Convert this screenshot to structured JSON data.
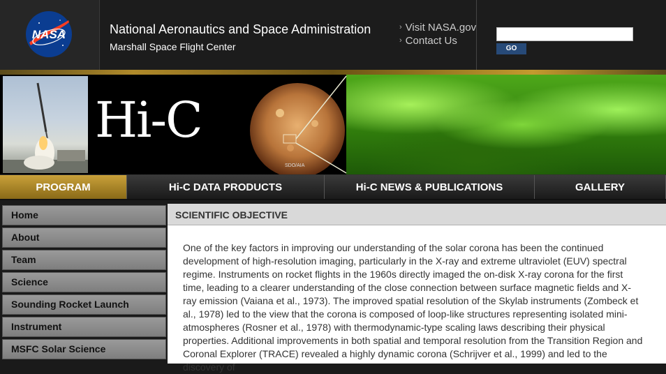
{
  "header": {
    "agency": "National Aeronautics and Space Administration",
    "center": "Marshall Space Flight Center",
    "links": [
      "Visit NASA.gov",
      "Contact Us"
    ],
    "search_placeholder": "",
    "go_label": "GO"
  },
  "banner": {
    "logo_text": "Hi-C",
    "sdo_label": "SDO/AIA"
  },
  "nav": {
    "tabs": [
      {
        "label": "PROGRAM"
      },
      {
        "label": "Hi-C DATA PRODUCTS"
      },
      {
        "label": "Hi-C NEWS & PUBLICATIONS"
      },
      {
        "label": "GALLERY"
      }
    ]
  },
  "sidebar": {
    "items": [
      {
        "label": "Home"
      },
      {
        "label": "About"
      },
      {
        "label": "Team"
      },
      {
        "label": "Science"
      },
      {
        "label": "Sounding Rocket Launch"
      },
      {
        "label": "Instrument"
      },
      {
        "label": "MSFC Solar Science"
      }
    ]
  },
  "main": {
    "title": "SCIENTIFIC OBJECTIVE",
    "body": "One of the key factors in improving our understanding of the solar corona has been the continued development of high-resolution imaging, particularly in the X-ray and extreme ultraviolet (EUV) spectral regime. Instruments on rocket flights in the 1960s directly imaged the on-disk X-ray corona for the first time, leading to a clearer understanding of the close connection between surface magnetic fields and X-ray emission (Vaiana et al., 1973). The improved spatial resolution of the Skylab instruments (Zombeck et al., 1978) led to the view that the corona is composed of loop-like structures representing isolated mini-atmospheres (Rosner et al., 1978) with thermodynamic-type scaling laws describing their physical properties. Additional improvements in both spatial and temporal resolution from the Transition Region and Coronal Explorer (TRACE) revealed a highly dynamic corona (Schrijver et al., 1999) and led to the discovery of"
  },
  "colors": {
    "accent_gold": "#c9a13a",
    "header_bg": "#1c1c1c",
    "go_button": "#274a78"
  }
}
